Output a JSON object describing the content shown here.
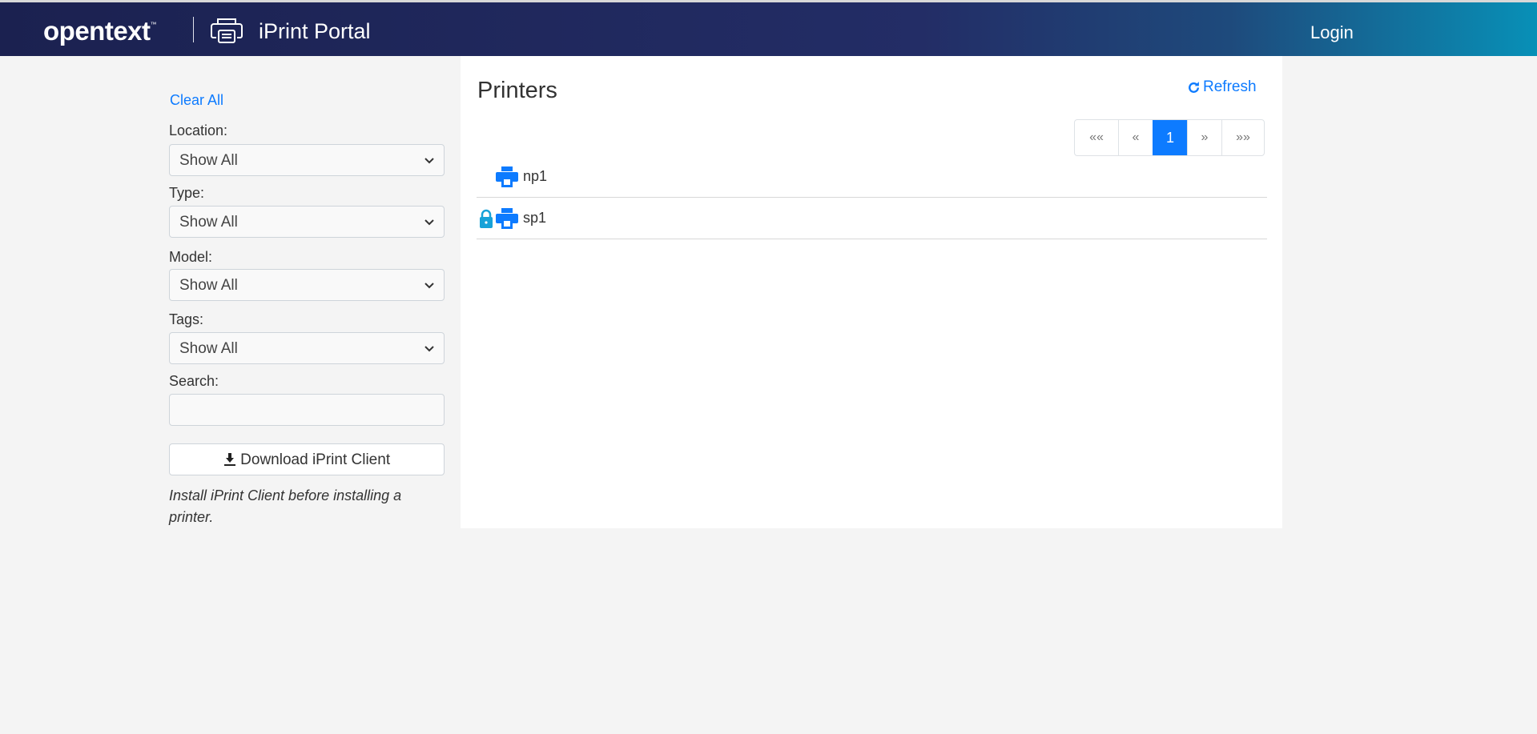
{
  "header": {
    "brand": "opentext",
    "brand_tm": "™",
    "app_title": "iPrint Portal",
    "login": "Login"
  },
  "sidebar": {
    "clear_all": "Clear All",
    "filters": [
      {
        "label": "Location:",
        "value": "Show All"
      },
      {
        "label": "Type:",
        "value": "Show All"
      },
      {
        "label": "Model:",
        "value": "Show All"
      },
      {
        "label": "Tags:",
        "value": "Show All"
      }
    ],
    "search_label": "Search:",
    "search_value": "",
    "download_label": "Download iPrint Client",
    "note": "Install iPrint Client before installing a printer."
  },
  "main": {
    "title": "Printers",
    "refresh": "Refresh",
    "pagination": [
      "««",
      "«",
      "1",
      "»",
      "»»"
    ],
    "printers": [
      {
        "name": "np1",
        "locked": false
      },
      {
        "name": "sp1",
        "locked": true
      }
    ]
  },
  "colors": {
    "accent": "#0d7bff",
    "lock": "#17a2d8"
  }
}
